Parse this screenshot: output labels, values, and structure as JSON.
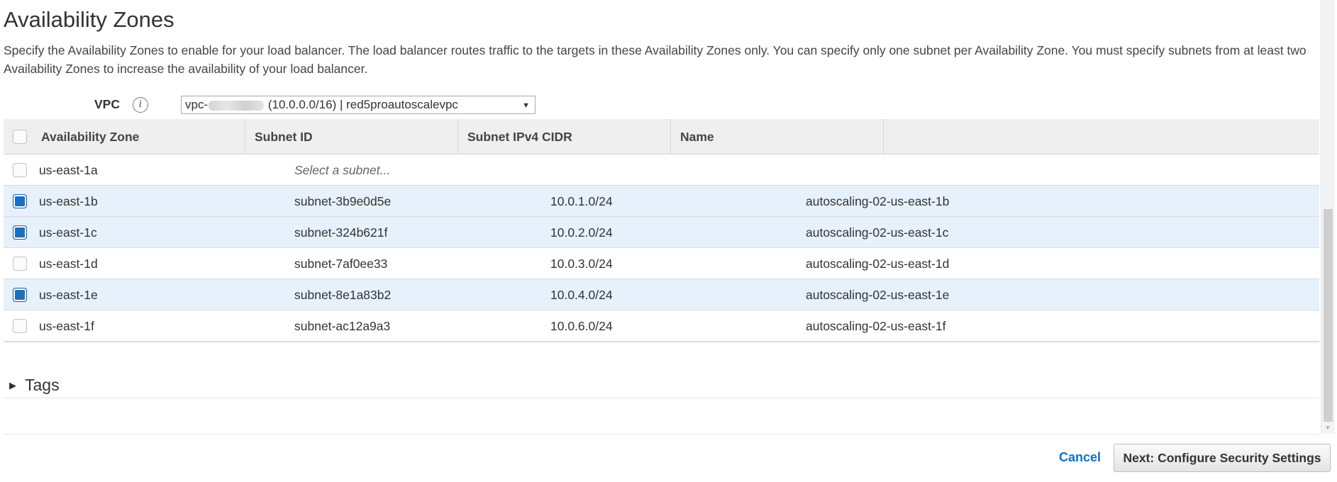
{
  "section": {
    "title": "Availability Zones",
    "description": "Specify the Availability Zones to enable for your load balancer. The load balancer routes traffic to the targets in these Availability Zones only. You can specify only one subnet per Availability Zone. You must specify subnets from at least two Availability Zones to increase the availability of your load balancer."
  },
  "vpc": {
    "label": "VPC",
    "info_icon": "info-icon",
    "selected_prefix": "vpc-",
    "selected_suffix": " (10.0.0.0/16) | red5proautoscalevpc",
    "caret": "▼"
  },
  "table": {
    "headers": {
      "az": "Availability Zone",
      "subnet": "Subnet ID",
      "cidr": "Subnet IPv4 CIDR",
      "name": "Name"
    },
    "rows": [
      {
        "az": "us-east-1a",
        "subnet": "Select a subnet...",
        "cidr": "",
        "name": "",
        "checked": false
      },
      {
        "az": "us-east-1b",
        "subnet": "subnet-3b9e0d5e",
        "cidr": "10.0.1.0/24",
        "name": "autoscaling-02-us-east-1b",
        "checked": true
      },
      {
        "az": "us-east-1c",
        "subnet": "subnet-324b621f",
        "cidr": "10.0.2.0/24",
        "name": "autoscaling-02-us-east-1c",
        "checked": true
      },
      {
        "az": "us-east-1d",
        "subnet": "subnet-7af0ee33",
        "cidr": "10.0.3.0/24",
        "name": "autoscaling-02-us-east-1d",
        "checked": false
      },
      {
        "az": "us-east-1e",
        "subnet": "subnet-8e1a83b2",
        "cidr": "10.0.4.0/24",
        "name": "autoscaling-02-us-east-1e",
        "checked": true
      },
      {
        "az": "us-east-1f",
        "subnet": "subnet-ac12a9a3",
        "cidr": "10.0.6.0/24",
        "name": "autoscaling-02-us-east-1f",
        "checked": false
      }
    ]
  },
  "tags": {
    "title": "Tags",
    "caret": "▶"
  },
  "footer": {
    "cancel_label": "Cancel",
    "next_label": "Next: Configure Security Settings"
  },
  "colors": {
    "accent": "#0a73c9",
    "selected_row": "#e6f1fb",
    "checkbox_checked": "#1a6fc2"
  }
}
